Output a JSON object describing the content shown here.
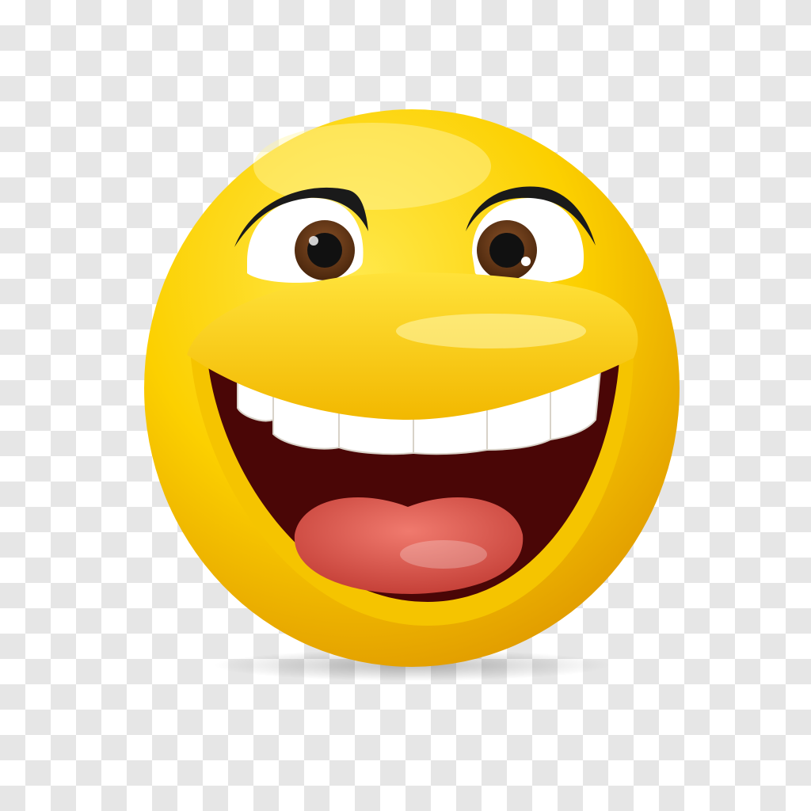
{
  "image": {
    "subject": "laughing-face-emoji",
    "background": "transparency-checkerboard"
  },
  "colors": {
    "face_light": "#ffe84a",
    "face_mid": "#fcd000",
    "face_dark": "#e09a00",
    "eye_white": "#ffffff",
    "iris": "#6b3b16",
    "pupil": "#111111",
    "brow": "#1a1a1a",
    "mouth_inside": "#4a0606",
    "teeth": "#ffffff",
    "tongue": "#e05a4e",
    "checker_light": "#ffffff",
    "checker_dark": "#e6e6e6"
  }
}
